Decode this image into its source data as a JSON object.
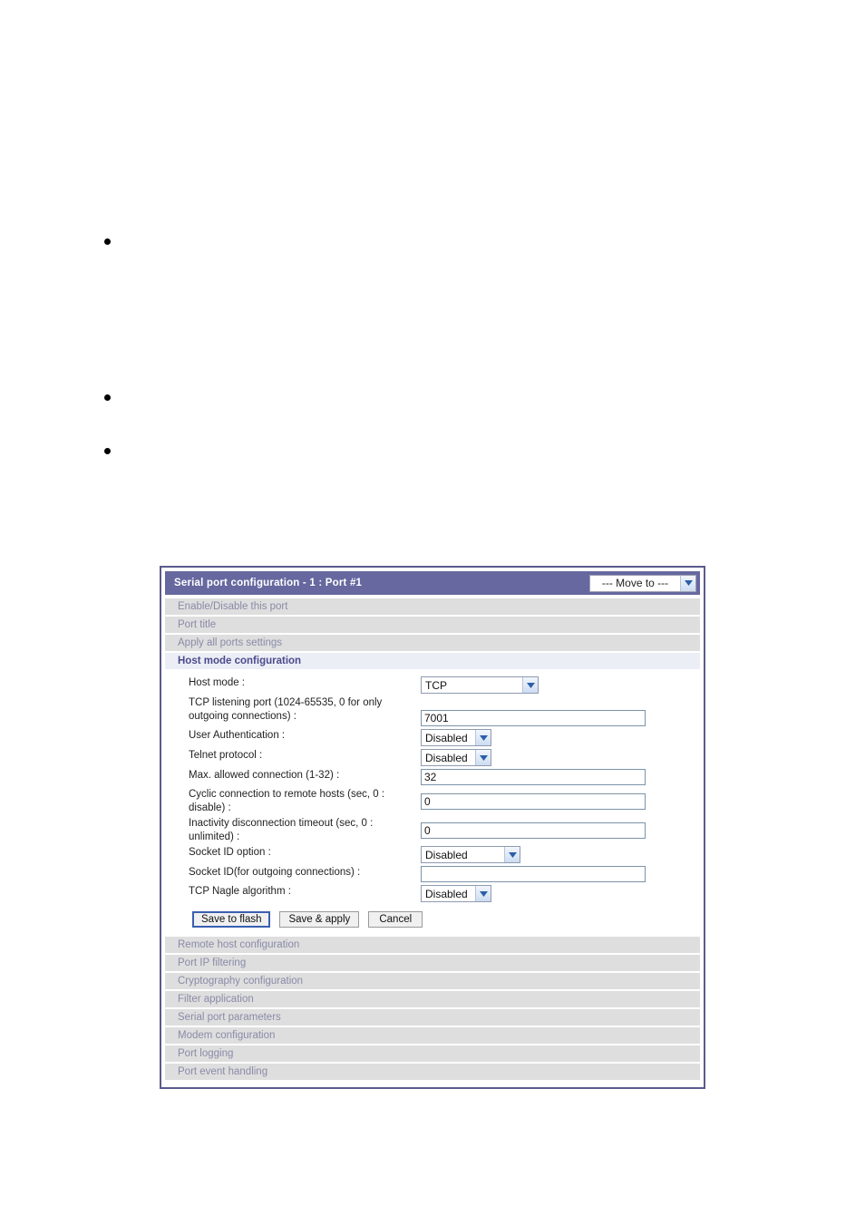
{
  "document": {
    "bullets": [
      "",
      "",
      ""
    ]
  },
  "panel": {
    "header": {
      "title": "Serial port configuration - 1 : Port #1",
      "move_to": {
        "selected": "--- Move to ---",
        "icon": "chevron-down-icon"
      }
    },
    "sections_top": [
      {
        "label": "Enable/Disable this port",
        "active": false
      },
      {
        "label": "Port title",
        "active": false
      },
      {
        "label": "Apply all ports settings",
        "active": false
      },
      {
        "label": "Host mode configuration",
        "active": true
      }
    ],
    "fields": [
      {
        "label": "Host mode :",
        "type": "select",
        "value": "TCP",
        "width": "w-wide",
        "name": "host-mode"
      },
      {
        "label": "TCP listening port (1024-65535, 0 for only outgoing connections) :",
        "type": "text",
        "value": "7001",
        "name": "tcp-listening-port"
      },
      {
        "label": "User Authentication :",
        "type": "select",
        "value": "Disabled",
        "width": "w-narrow",
        "name": "user-authentication"
      },
      {
        "label": "Telnet protocol :",
        "type": "select",
        "value": "Disabled",
        "width": "w-narrow",
        "name": "telnet-protocol"
      },
      {
        "label": "Max. allowed connection (1-32) :",
        "type": "text",
        "value": "32",
        "name": "max-allowed-connection"
      },
      {
        "label": "Cyclic connection to remote hosts (sec, 0 : disable) :",
        "type": "text",
        "value": "0",
        "name": "cyclic-connection"
      },
      {
        "label": "Inactivity disconnection timeout (sec, 0 : unlimited) :",
        "type": "text",
        "value": "0",
        "name": "inactivity-timeout"
      },
      {
        "label": "Socket ID option :",
        "type": "select",
        "value": "Disabled",
        "width": "w-med",
        "name": "socket-id-option"
      },
      {
        "label": "Socket ID(for outgoing connections) :",
        "type": "text",
        "value": "",
        "name": "socket-id"
      },
      {
        "label": "TCP Nagle algorithm :",
        "type": "select",
        "value": "Disabled",
        "width": "w-narrow",
        "name": "tcp-nagle-algorithm"
      }
    ],
    "buttons": [
      {
        "label": "Save to flash",
        "focused": true,
        "name": "save-to-flash-button"
      },
      {
        "label": "Save & apply",
        "focused": false,
        "name": "save-and-apply-button"
      },
      {
        "label": "Cancel",
        "focused": false,
        "name": "cancel-button"
      }
    ],
    "sections_bottom": [
      {
        "label": "Remote host configuration"
      },
      {
        "label": "Port IP filtering"
      },
      {
        "label": "Cryptography configuration"
      },
      {
        "label": "Filter application"
      },
      {
        "label": "Serial port parameters"
      },
      {
        "label": "Modem configuration"
      },
      {
        "label": "Port logging"
      },
      {
        "label": "Port event handling"
      }
    ],
    "colors": {
      "header_bg": "#66689f",
      "panel_border": "#5b5a8c",
      "section_bg": "#dedede",
      "section_text": "#8a8aa8",
      "active_section_bg": "#eceef6",
      "active_section_text": "#4a4a8c",
      "focus_outline": "#3a5fb0"
    }
  }
}
